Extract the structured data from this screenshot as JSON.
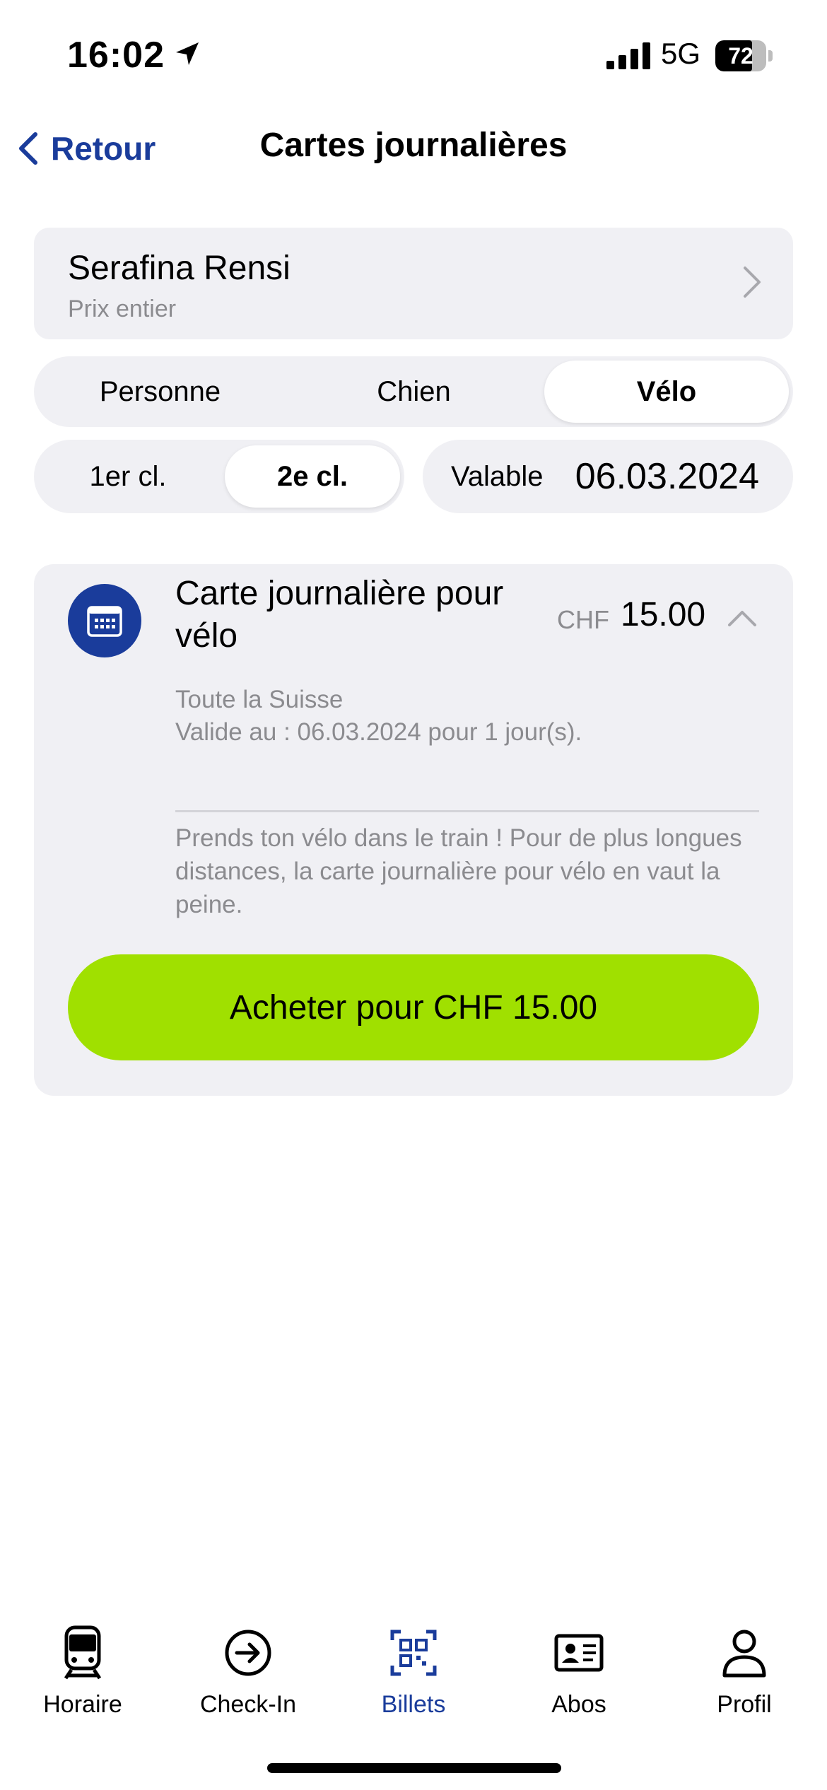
{
  "status_bar": {
    "time": "16:02",
    "network": "5G",
    "battery_level": "72",
    "battery_fraction": 0.72,
    "icons": [
      "location-arrow-icon",
      "signal-icon",
      "battery-icon"
    ]
  },
  "nav": {
    "back_label": "Retour",
    "title": "Cartes journalières",
    "back_icon": "chevron-left-icon"
  },
  "passenger": {
    "name": "Serafina Rensi",
    "fare": "Prix entier",
    "icon": "chevron-right-icon"
  },
  "type_segment": {
    "options": [
      "Personne",
      "Chien",
      "Vélo"
    ],
    "selected": "Vélo"
  },
  "class_segment": {
    "options": [
      "1er cl.",
      "2e cl."
    ],
    "selected": "2e cl."
  },
  "validity": {
    "label": "Valable",
    "date": "06.03.2024"
  },
  "ticket": {
    "icon": "calendar-icon",
    "title": "Carte journalière pour vélo",
    "currency": "CHF",
    "price": "15.00",
    "expand_icon": "chevron-up-icon",
    "zone": "Toute la Suisse",
    "validity_text": "Valide au : 06.03.2024 pour 1 jour(s).",
    "description": "Prends ton vélo dans le train ! Pour de plus longues distances, la carte journalière pour vélo en vaut la peine.",
    "buy_label": "Acheter pour CHF 15.00"
  },
  "colors": {
    "accent_blue": "#1a3c9b",
    "buy_green": "#a0e000",
    "card_gray": "#f0f0f4",
    "muted_text": "#8b8b8f"
  },
  "tab_bar": {
    "tabs": [
      {
        "label": "Horaire",
        "icon": "train-icon"
      },
      {
        "label": "Check-In",
        "icon": "check-in-arrow-icon"
      },
      {
        "label": "Billets",
        "icon": "qr-ticket-icon"
      },
      {
        "label": "Abos",
        "icon": "id-card-icon"
      },
      {
        "label": "Profil",
        "icon": "person-icon"
      }
    ],
    "active": "Billets"
  }
}
